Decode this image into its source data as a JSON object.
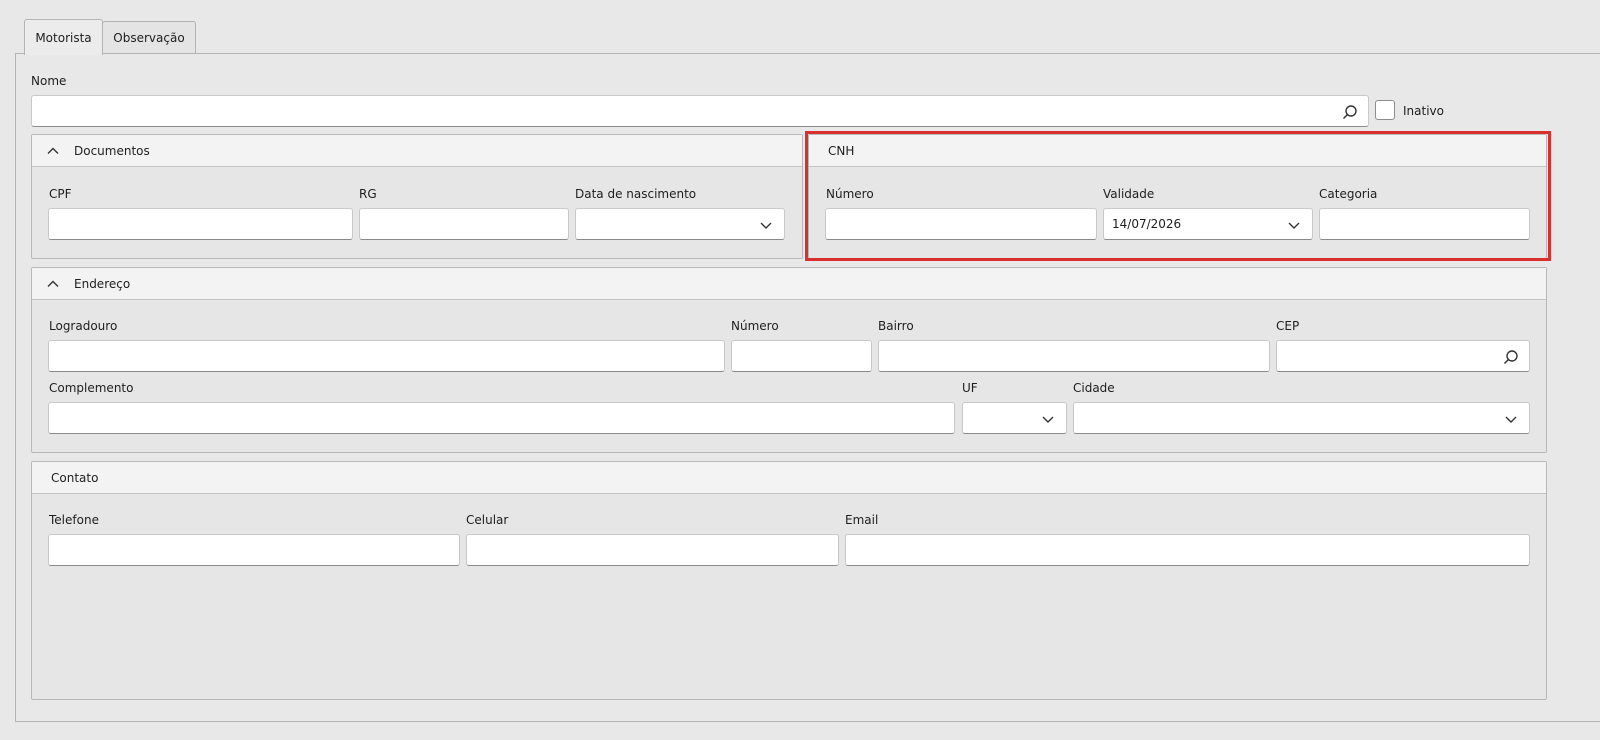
{
  "tabs": [
    {
      "label": "Motorista",
      "active": true
    },
    {
      "label": "Observação",
      "active": false
    }
  ],
  "nome": {
    "label": "Nome",
    "value": "",
    "icon": "search-icon"
  },
  "inativo": {
    "label": "Inativo",
    "checked": false
  },
  "documentos": {
    "title": "Documentos",
    "collapse_icon": "chevron-up-icon",
    "cpf": {
      "label": "CPF",
      "value": ""
    },
    "rg": {
      "label": "RG",
      "value": ""
    },
    "data_nascimento": {
      "label": "Data de nascimento",
      "value": "",
      "icon": "chevron-down-icon"
    }
  },
  "cnh": {
    "title": "CNH",
    "numero": {
      "label": "Número",
      "value": ""
    },
    "validade": {
      "label": "Validade",
      "value": "14/07/2026",
      "icon": "chevron-down-icon"
    },
    "categoria": {
      "label": "Categoria",
      "value": ""
    },
    "highlight_color": "#d9302f"
  },
  "endereco": {
    "title": "Endereço",
    "collapse_icon": "chevron-up-icon",
    "logradouro": {
      "label": "Logradouro",
      "value": ""
    },
    "numero": {
      "label": "Número",
      "value": ""
    },
    "bairro": {
      "label": "Bairro",
      "value": ""
    },
    "cep": {
      "label": "CEP",
      "value": "",
      "icon": "search-icon"
    },
    "complemento": {
      "label": "Complemento",
      "value": ""
    },
    "uf": {
      "label": "UF",
      "value": "",
      "icon": "chevron-down-icon"
    },
    "cidade": {
      "label": "Cidade",
      "value": "",
      "icon": "chevron-down-icon"
    }
  },
  "contato": {
    "title": "Contato",
    "telefone": {
      "label": "Telefone",
      "value": ""
    },
    "celular": {
      "label": "Celular",
      "value": ""
    },
    "email": {
      "label": "Email",
      "value": ""
    }
  }
}
